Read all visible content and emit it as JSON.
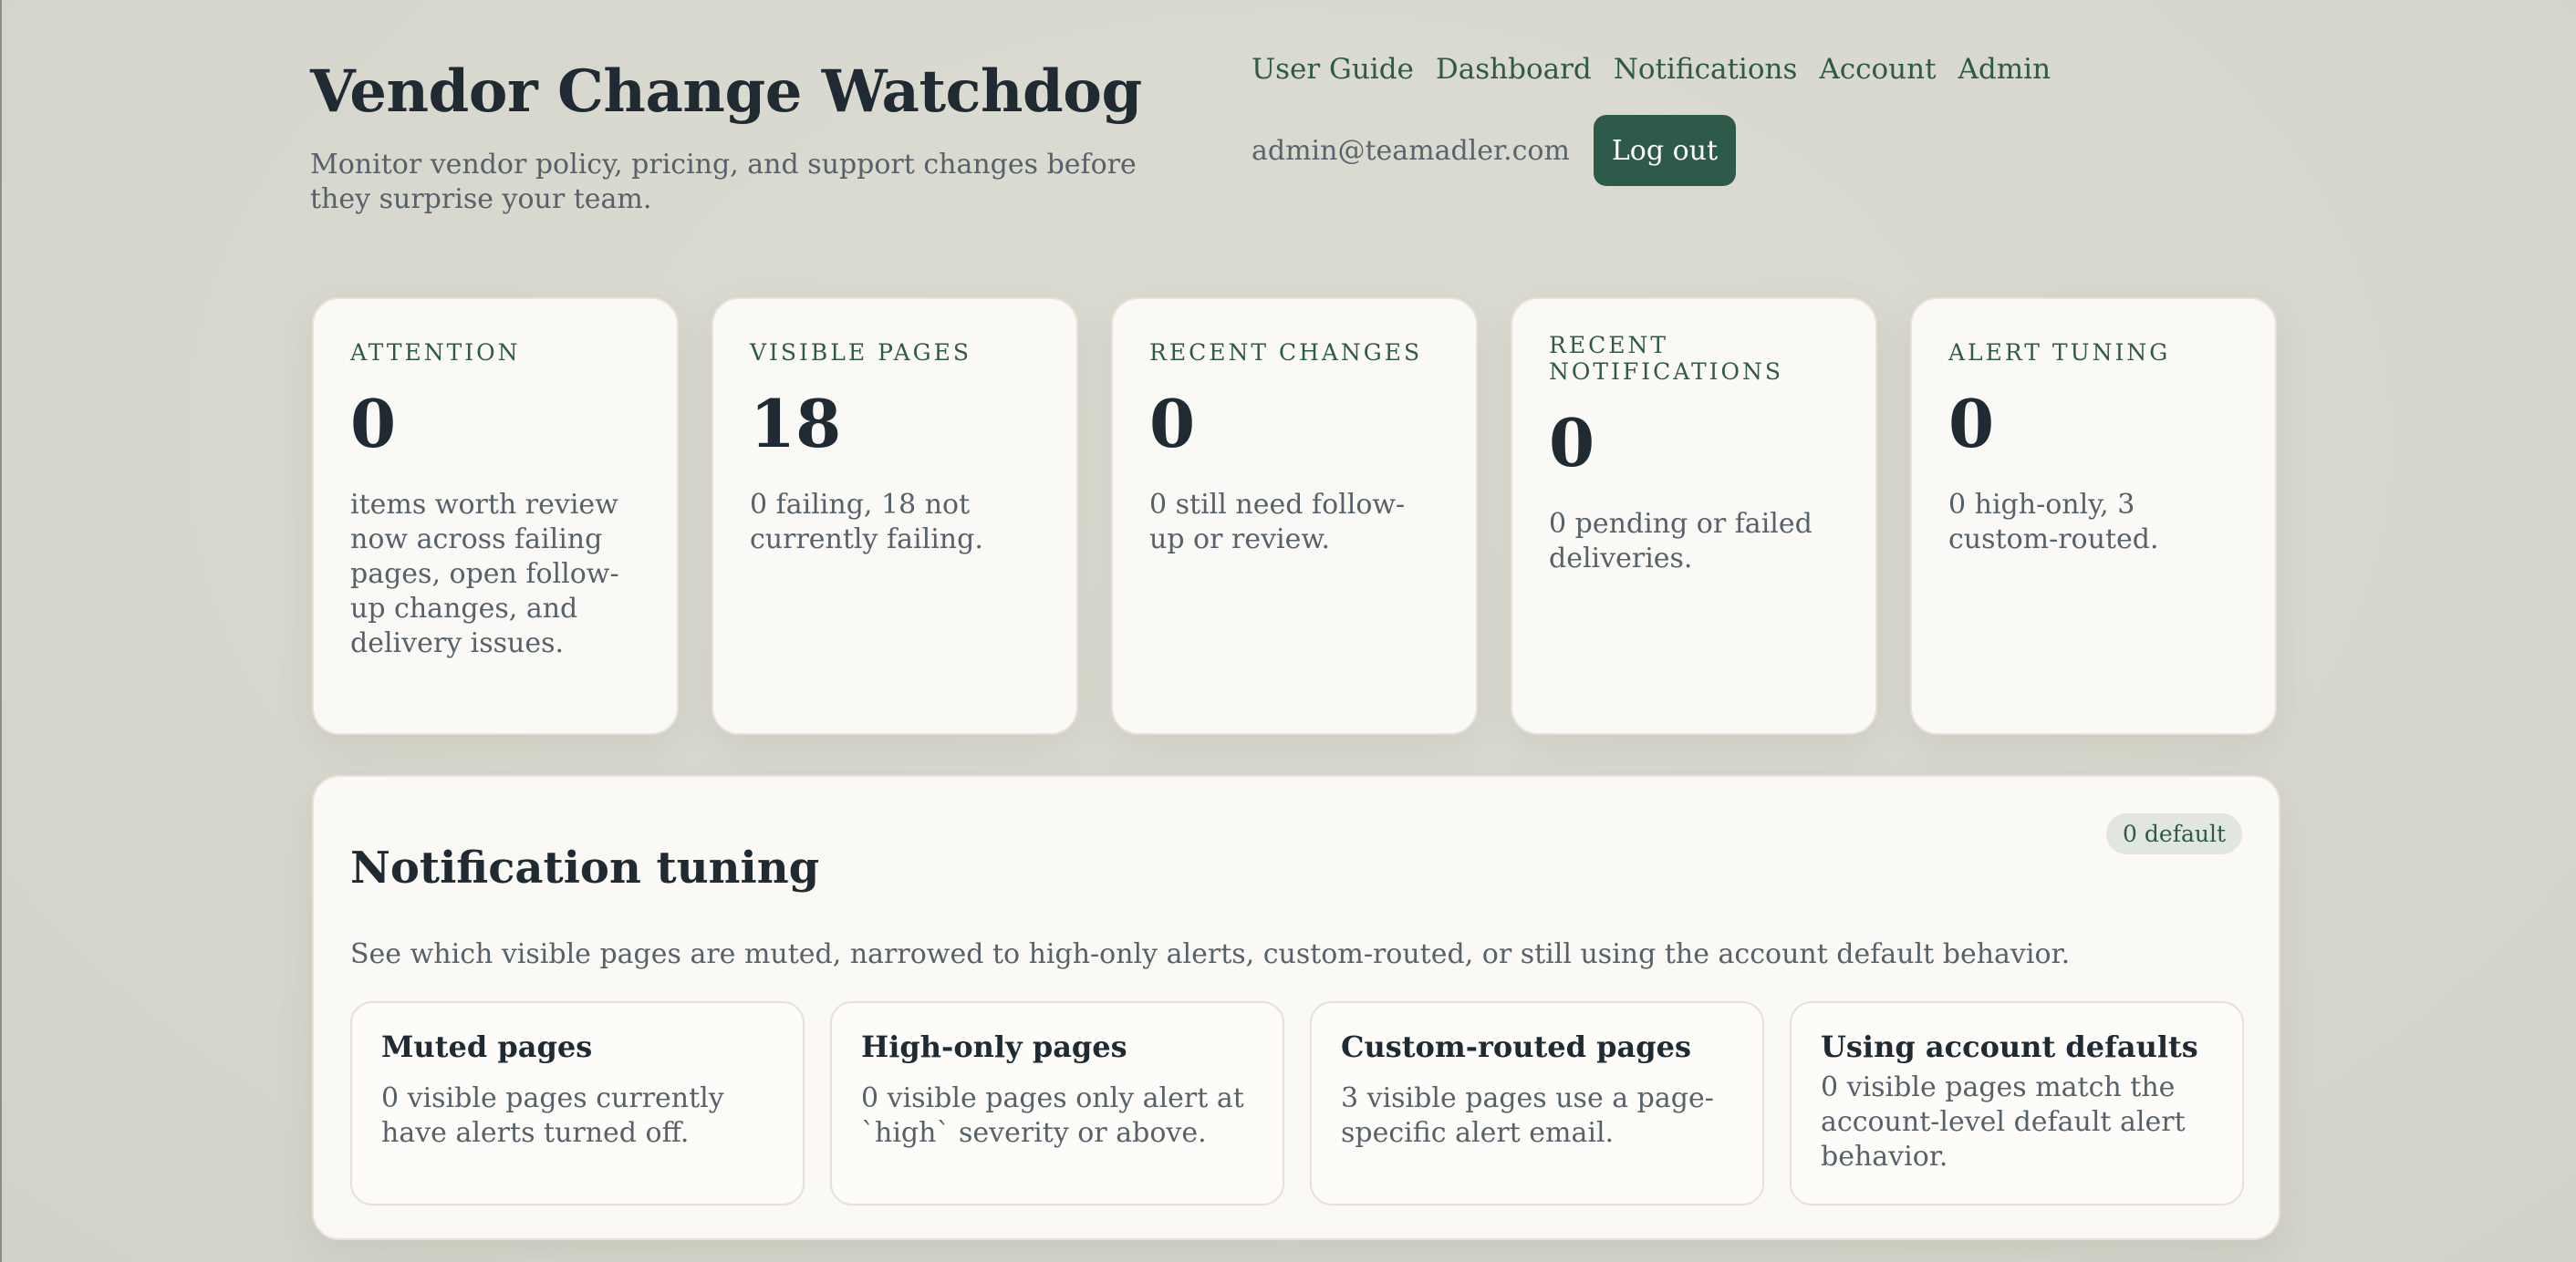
{
  "app": {
    "title": "Vendor Change Watchdog",
    "subtitle": "Monitor vendor policy, pricing, and support changes before they surprise your team."
  },
  "nav": {
    "items": [
      {
        "label": "User Guide"
      },
      {
        "label": "Dashboard"
      },
      {
        "label": "Notifications"
      },
      {
        "label": "Account"
      },
      {
        "label": "Admin"
      }
    ]
  },
  "user": {
    "email": "admin@teamadler.com",
    "logout_label": "Log out"
  },
  "stats": [
    {
      "label": "ATTENTION",
      "value": "0",
      "desc": "items worth review now across failing pages, open follow-up changes, and delivery issues."
    },
    {
      "label": "VISIBLE PAGES",
      "value": "18",
      "desc": "0 failing, 18 not currently failing."
    },
    {
      "label": "RECENT CHANGES",
      "value": "0",
      "desc": "0 still need follow-up or review."
    },
    {
      "label": "RECENT NOTIFICATIONS",
      "value": "0",
      "desc": "0 pending or failed deliveries."
    },
    {
      "label": "ALERT TUNING",
      "value": "0",
      "desc": "0 high-only, 3 custom-routed."
    }
  ],
  "tuning": {
    "title": "Notification tuning",
    "badge": "0 default",
    "description": "See which visible pages are muted, narrowed to high-only alerts, custom-routed, or still using the account default behavior.",
    "cards": [
      {
        "title": "Muted pages",
        "desc": "0 visible pages currently have alerts turned off."
      },
      {
        "title": "High-only pages",
        "desc": "0 visible pages only alert at `high` severity or above."
      },
      {
        "title": "Custom-routed pages",
        "desc": "3 visible pages use a page-specific alert email."
      },
      {
        "title": "Using account defaults",
        "desc": "0 visible pages match the account-level default alert behavior."
      }
    ]
  },
  "colors": {
    "accent": "#2e5b49",
    "background": "#d8d8ce",
    "card": "#fbf9f5",
    "text": "#1f2a33",
    "muted_text": "#56616a"
  }
}
